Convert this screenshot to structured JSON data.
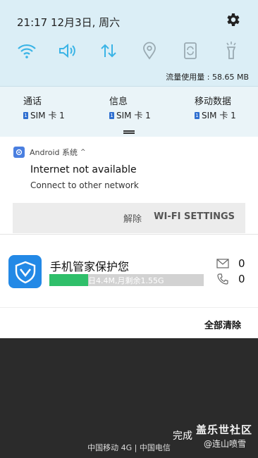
{
  "status": {
    "time_date": "21:17  12月3日, 周六"
  },
  "quick_settings": {
    "tiles": [
      {
        "name": "wifi",
        "icon": "wifi-icon",
        "active": true
      },
      {
        "name": "sound",
        "icon": "speaker-icon",
        "active": true
      },
      {
        "name": "mobile-data",
        "icon": "data-arrows-icon",
        "active": true
      },
      {
        "name": "location",
        "icon": "location-pin-icon",
        "active": false
      },
      {
        "name": "rotation",
        "icon": "rotate-icon",
        "active": false
      },
      {
        "name": "flashlight",
        "icon": "flashlight-icon",
        "active": false
      }
    ],
    "accent_color": "#3ab4e6",
    "inactive_color": "#9aaab2",
    "data_usage": "流量使用量 : 58.65 MB"
  },
  "sim": {
    "badge": "1",
    "columns": [
      {
        "title": "通话",
        "sim": "SIM 卡 1"
      },
      {
        "title": "信息",
        "sim": "SIM 卡 1"
      },
      {
        "title": "移动数据",
        "sim": "SIM 卡 1"
      }
    ]
  },
  "notification": {
    "app_name": "Android 系统",
    "chevron": "^",
    "title": "Internet not available",
    "text": "Connect to other network",
    "actions": {
      "dismiss": "解除",
      "wifi_settings": "WI-FI SETTINGS"
    }
  },
  "guard": {
    "title": "手机管家保护您",
    "bar_text": "日4.4M,月剩余1.55G",
    "bar_fill_fraction": 0.25,
    "messages": "0",
    "calls": "0"
  },
  "clear_all": "全部清除",
  "bottom": {
    "complete": "完成",
    "carrier": "中国移动 4G | 中国电信"
  },
  "watermark": {
    "line1": "盖乐世社区",
    "line2": "@连山喷雪"
  }
}
